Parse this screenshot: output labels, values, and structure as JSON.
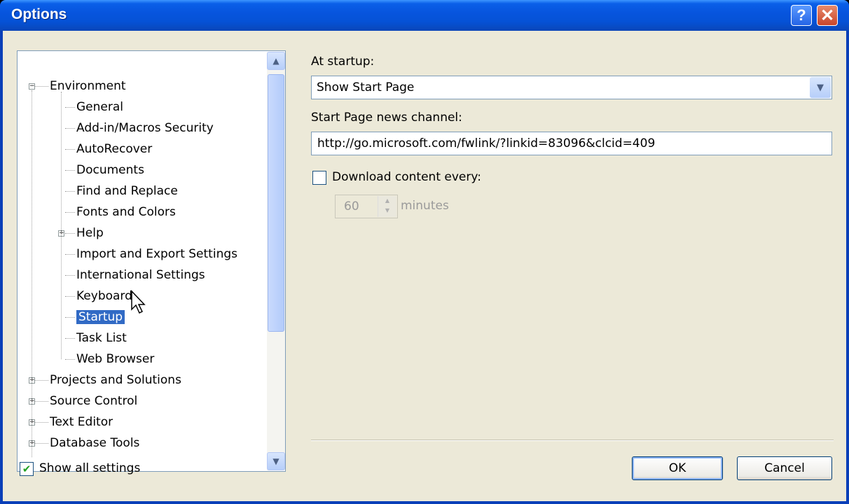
{
  "window": {
    "title": "Options",
    "help_glyph": "?",
    "close_glyph": "✕"
  },
  "tree": {
    "items": [
      {
        "label": "Environment",
        "level": 0,
        "expander": "minus"
      },
      {
        "label": "General",
        "level": 1
      },
      {
        "label": "Add-in/Macros Security",
        "level": 1
      },
      {
        "label": "AutoRecover",
        "level": 1
      },
      {
        "label": "Documents",
        "level": 1
      },
      {
        "label": "Find and Replace",
        "level": 1
      },
      {
        "label": "Fonts and Colors",
        "level": 1
      },
      {
        "label": "Help",
        "level": 1,
        "expander": "plus"
      },
      {
        "label": "Import and Export Settings",
        "level": 1
      },
      {
        "label": "International Settings",
        "level": 1
      },
      {
        "label": "Keyboard",
        "level": 1
      },
      {
        "label": "Startup",
        "level": 1,
        "selected": true
      },
      {
        "label": "Task List",
        "level": 1
      },
      {
        "label": "Web Browser",
        "level": 1
      },
      {
        "label": "Projects and Solutions",
        "level": 0,
        "expander": "plus"
      },
      {
        "label": "Source Control",
        "level": 0,
        "expander": "plus"
      },
      {
        "label": "Text Editor",
        "level": 0,
        "expander": "plus"
      },
      {
        "label": "Database Tools",
        "level": 0,
        "expander": "plus"
      }
    ]
  },
  "startup": {
    "at_startup_label": "At startup:",
    "at_startup_value": "Show Start Page",
    "news_channel_label": "Start Page news channel:",
    "news_channel_value": "http://go.microsoft.com/fwlink/?linkid=83096&clcid=409",
    "download_label": "Download content every:",
    "download_checked": false,
    "download_interval": "60",
    "minutes_label": "minutes"
  },
  "footer": {
    "show_all_label": "Show all settings",
    "show_all_checked": true,
    "ok_label": "OK",
    "cancel_label": "Cancel"
  },
  "colors": {
    "titlebar": "#0A5FE8",
    "dialog_bg": "#ECE9D8",
    "selection": "#316AC5"
  }
}
